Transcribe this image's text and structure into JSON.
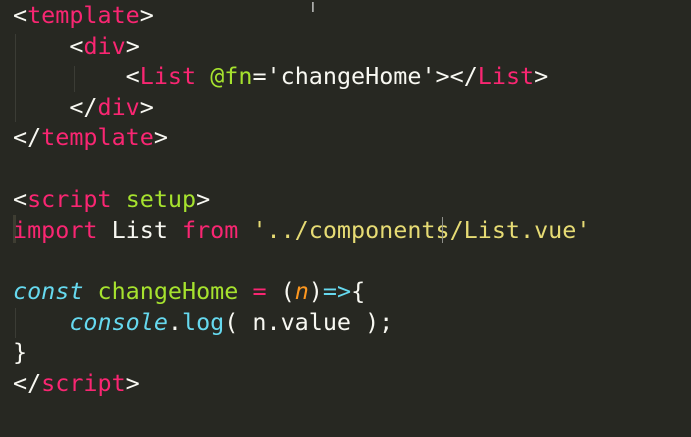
{
  "editor": {
    "lines": {
      "l1": [
        "<",
        "template",
        ">"
      ],
      "l2": [
        "<",
        "div",
        ">"
      ],
      "l3": [
        "<",
        "List",
        " ",
        "@fn",
        "=",
        "'changeHome'",
        "></",
        "List",
        ">"
      ],
      "l4": [
        "</",
        "div",
        ">"
      ],
      "l5": [
        "</",
        "template",
        ">"
      ],
      "l7": [
        "<",
        "script",
        " ",
        "setup",
        ">"
      ],
      "l8": [
        "import",
        " List ",
        "from",
        " ",
        "'../components/List.vue'"
      ],
      "l10": [
        "const",
        " ",
        "changeHome",
        " ",
        "=",
        " (",
        "n",
        ")",
        "=>",
        "{"
      ],
      "l11": [
        "console",
        ".",
        "log",
        "( n.value );"
      ],
      "l12": [
        "}"
      ],
      "l13": [
        "</",
        "script",
        ">"
      ]
    },
    "mouse_cursor": "I"
  },
  "colors": {
    "background": "#272822",
    "tag": "#f92672",
    "attribute": "#a6e22e",
    "string": "#e6db74",
    "keyword": "#66d9ef",
    "parameter": "#fd971f",
    "text": "#f8f8f2"
  }
}
